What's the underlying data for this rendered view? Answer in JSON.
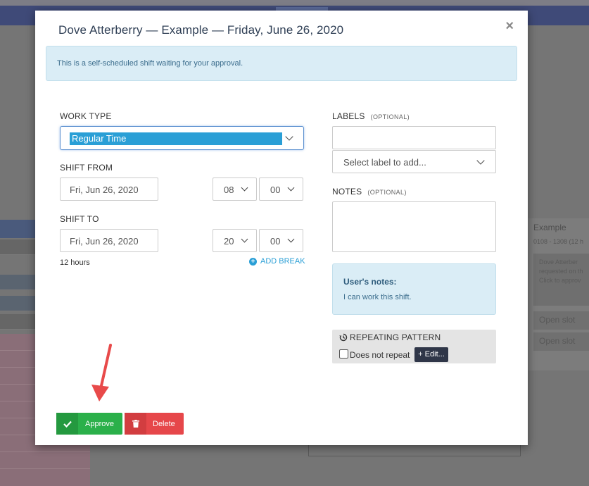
{
  "modal": {
    "title": "Dove Atterberry — Example — Friday, June 26, 2020",
    "close_label": "×",
    "alert_text": "This is a self-scheduled shift waiting for your approval."
  },
  "form": {
    "work_type_label": "WORK TYPE",
    "work_type_value": "Regular Time",
    "shift_from_label": "SHIFT FROM",
    "shift_from_date": "Fri, Jun 26, 2020",
    "shift_from_hour": "08",
    "shift_from_minute": "00",
    "shift_to_label": "SHIFT TO",
    "shift_to_date": "Fri, Jun 26, 2020",
    "shift_to_hour": "20",
    "shift_to_minute": "00",
    "duration_text": "12 hours",
    "add_break_label": "ADD BREAK"
  },
  "labels": {
    "label": "LABELS",
    "optional": "(OPTIONAL)",
    "select_placeholder": "Select label to add..."
  },
  "notes": {
    "label": "NOTES",
    "optional": "(OPTIONAL)"
  },
  "user_notes": {
    "heading": "User's notes:",
    "text": "I can work this shift."
  },
  "repeating": {
    "heading": "REPEATING PATTERN",
    "checkbox_label": "Does not repeat",
    "edit_label": "+ Edit..."
  },
  "actions": {
    "approve_label": "Approve",
    "delete_label": "Delete"
  },
  "background": {
    "panel_title": "Example",
    "panel_sub": "0108 - 1308 (12 h",
    "card_lines": [
      "Dove Atterber",
      "requested on th",
      "Click to approv"
    ],
    "slots": [
      "Open slot",
      "Open slot"
    ]
  },
  "colors": {
    "accent": "#2a9fd6",
    "approve": "#2bb04a",
    "delete": "#e6474a",
    "alert_bg": "#daedf6",
    "arrow": "#e84a4a"
  }
}
